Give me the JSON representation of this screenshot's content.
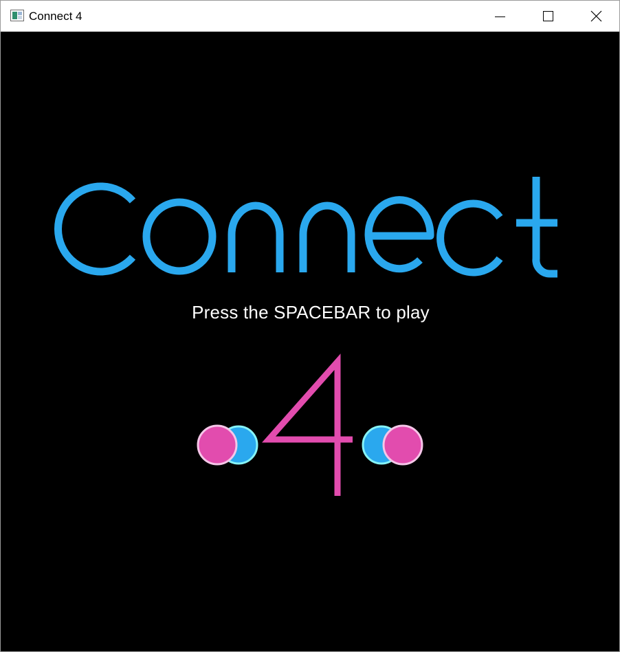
{
  "window": {
    "title": "Connect 4",
    "controls": {
      "minimize": "minimize-icon",
      "maximize": "maximize-icon",
      "close": "close-icon"
    }
  },
  "game": {
    "title_word": "Connect",
    "number": "4",
    "prompt": "Press the SPACEBAR to play",
    "colors": {
      "background": "#000000",
      "title": "#2aa8ee",
      "number": "#e24cae",
      "prompt": "#ffffff",
      "blue_disc": "#2aa8ee",
      "blue_disc_outline": "#86f3f6",
      "pink_disc": "#e24cae",
      "pink_disc_outline": "#f5c6e8"
    }
  }
}
